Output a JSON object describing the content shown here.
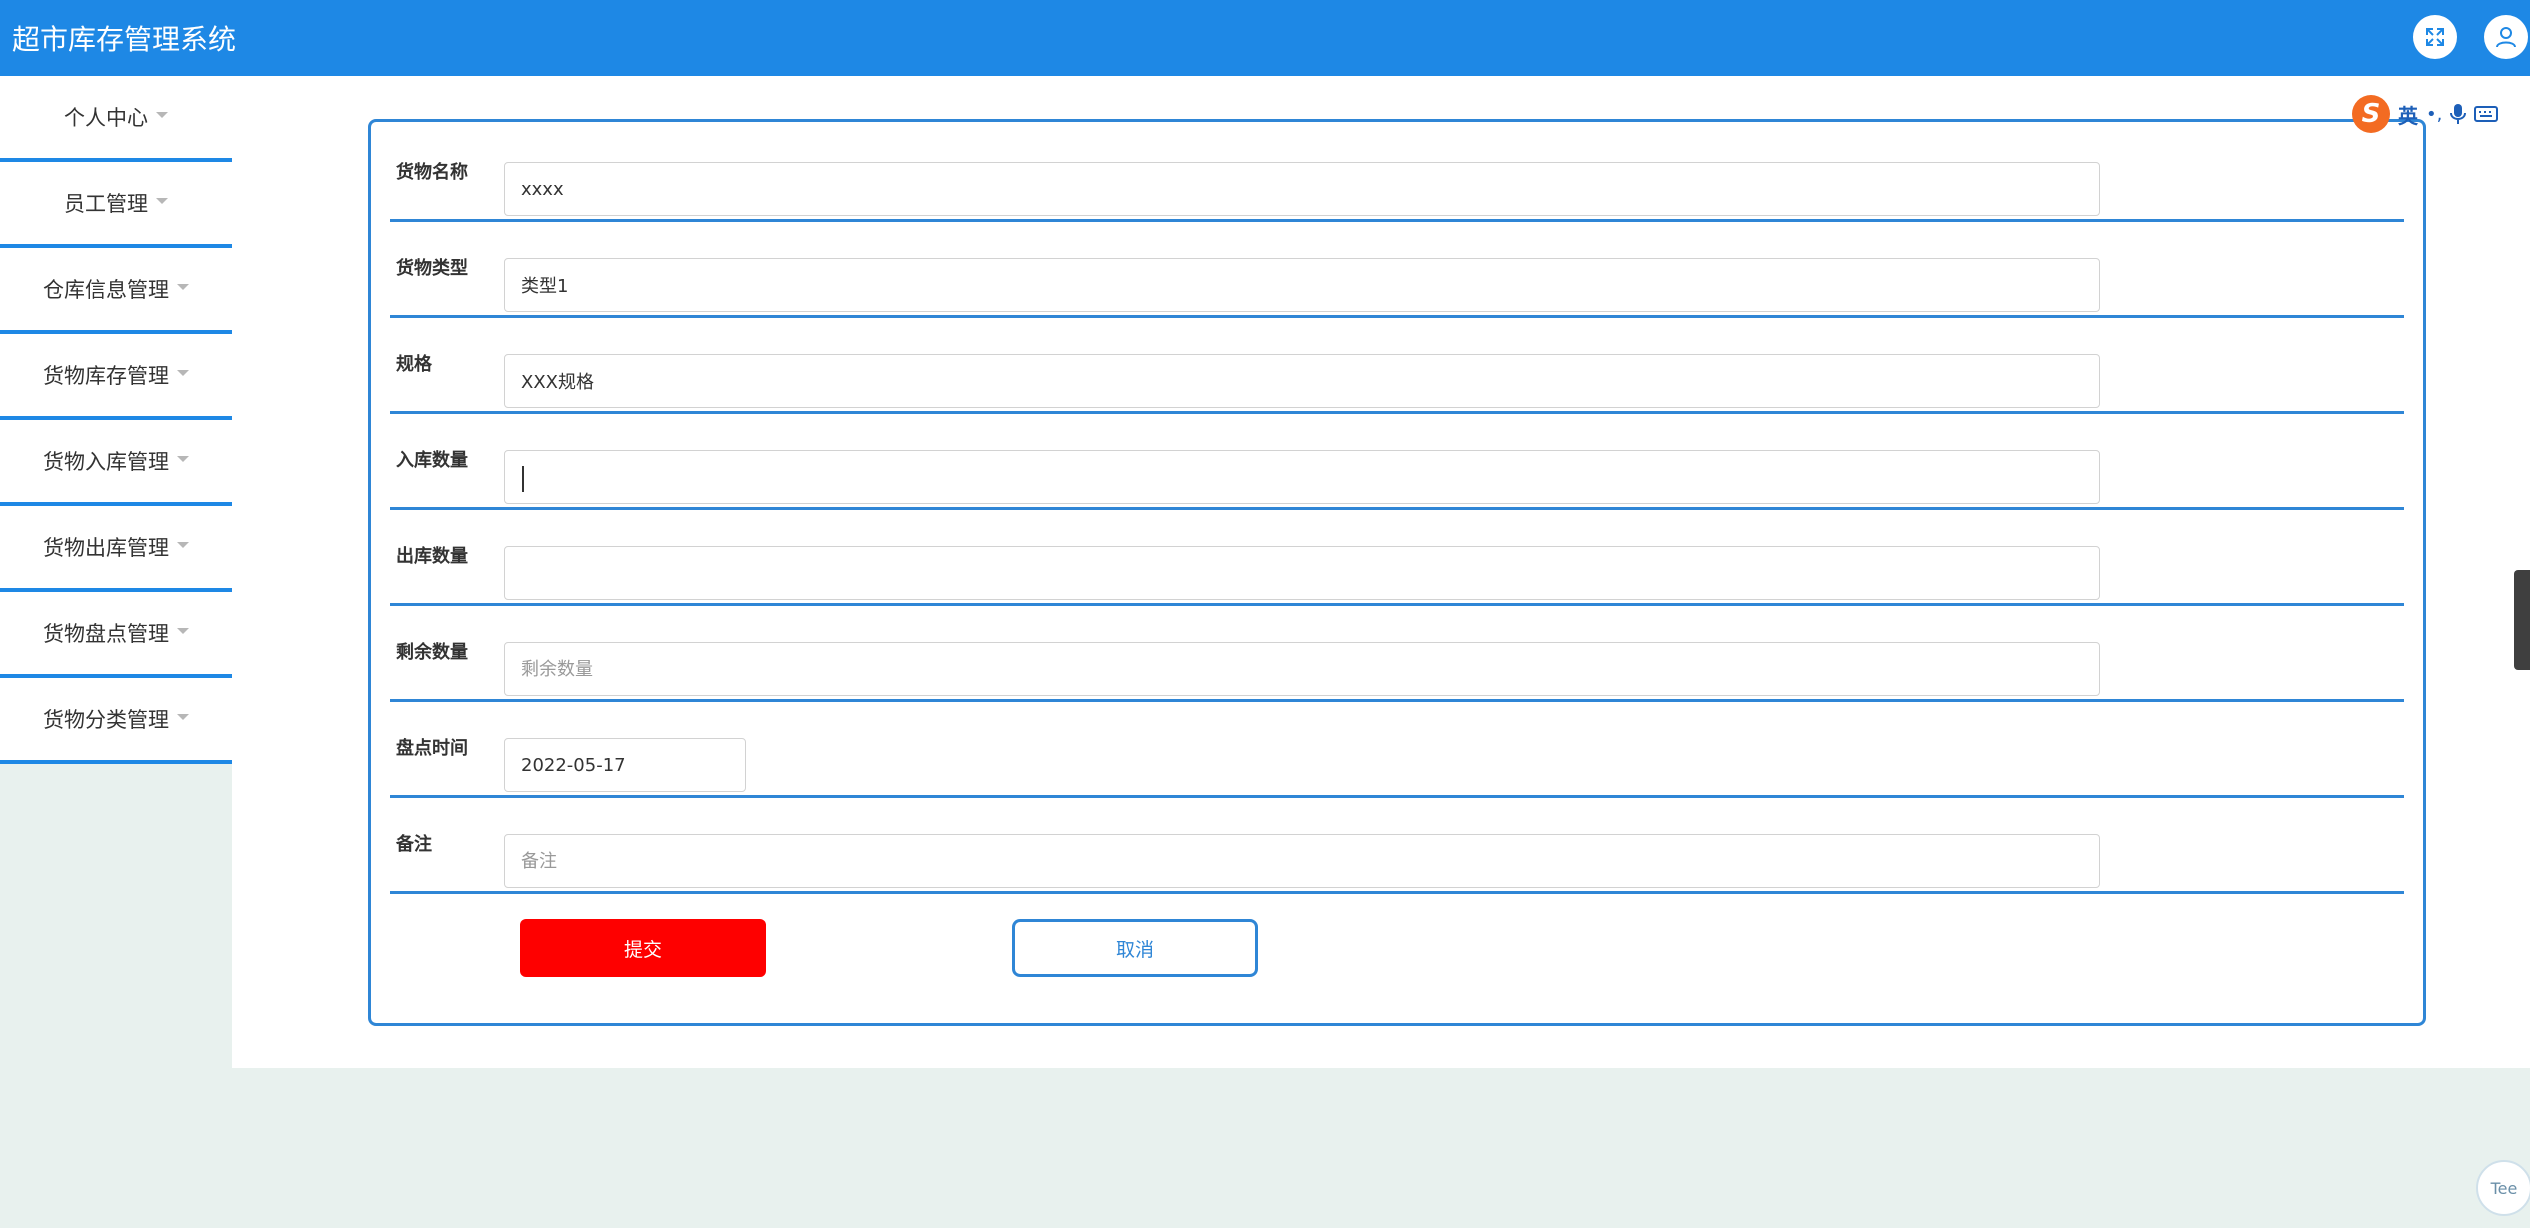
{
  "header": {
    "title": "超市库存管理系统"
  },
  "sidebar": {
    "items": [
      {
        "label": "个人中心"
      },
      {
        "label": "员工管理"
      },
      {
        "label": "仓库信息管理"
      },
      {
        "label": "货物库存管理"
      },
      {
        "label": "货物入库管理"
      },
      {
        "label": "货物出库管理"
      },
      {
        "label": "货物盘点管理"
      },
      {
        "label": "货物分类管理"
      }
    ]
  },
  "form": {
    "fields": [
      {
        "label": "货物名称",
        "value": "xxxx",
        "placeholder": ""
      },
      {
        "label": "货物类型",
        "value": "类型1",
        "placeholder": ""
      },
      {
        "label": "规格",
        "value": "XXX规格",
        "placeholder": ""
      },
      {
        "label": "入库数量",
        "value": "",
        "placeholder": ""
      },
      {
        "label": "出库数量",
        "value": "",
        "placeholder": ""
      },
      {
        "label": "剩余数量",
        "value": "",
        "placeholder": "剩余数量"
      },
      {
        "label": "盘点时间",
        "value": "2022-05-17",
        "placeholder": ""
      },
      {
        "label": "备注",
        "value": "",
        "placeholder": "备注"
      }
    ],
    "submit_label": "提交",
    "cancel_label": "取消"
  },
  "ime": {
    "logo": "S",
    "mode": "英",
    "punct": "•,",
    "icons": [
      "microphone-icon",
      "keyboard-icon"
    ]
  },
  "corner_widget": {
    "label": "Tee"
  },
  "colors": {
    "header": "#1e88e5",
    "accent": "#2f86d6",
    "submit": "#fe0000",
    "background": "#e8f1ee"
  }
}
